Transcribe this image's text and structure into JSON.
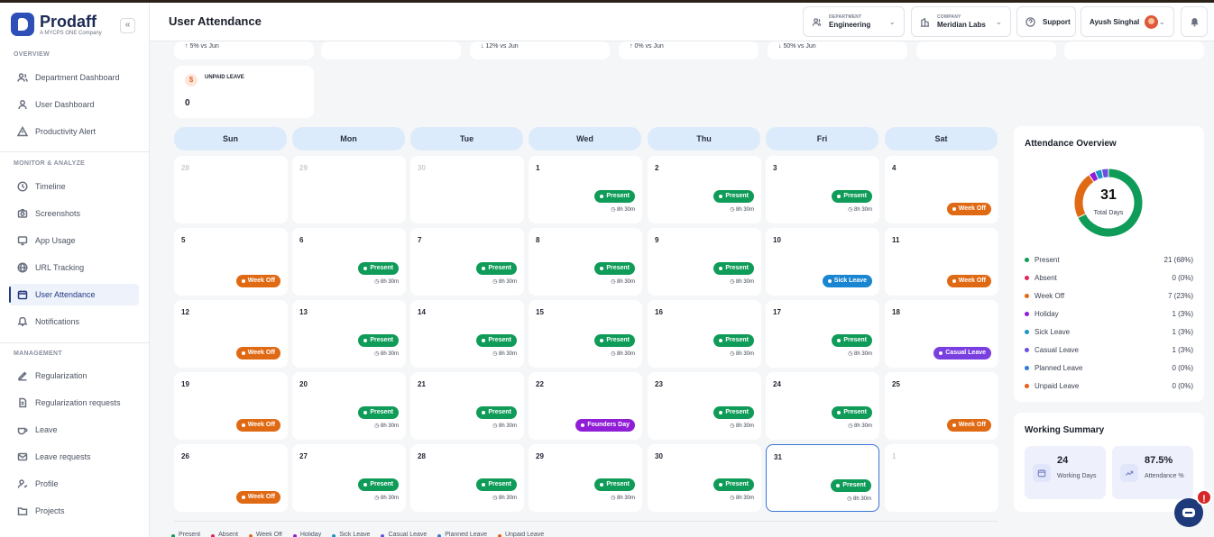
{
  "brand": {
    "name": "Prodaff",
    "tagline": "A MYCPS ONE Company",
    "collapse_icon": "«"
  },
  "sidebar": {
    "sections": [
      {
        "label": "OVERVIEW",
        "items": [
          "Department Dashboard",
          "User Dashboard",
          "Productivity Alert"
        ]
      },
      {
        "label": "MONITOR & ANALYZE",
        "items": [
          "Timeline",
          "Screenshots",
          "App Usage",
          "URL Tracking",
          "User Attendance",
          "Notifications"
        ]
      },
      {
        "label": "MANAGEMENT",
        "items": [
          "Regularization",
          "Regularization requests",
          "Leave",
          "Leave requests",
          "Profile",
          "Projects"
        ]
      }
    ],
    "active_item": "User Attendance"
  },
  "header": {
    "title": "User Attendance",
    "department": {
      "label": "DEPARTMENT",
      "value": "Engineering"
    },
    "company": {
      "label": "COMPANY",
      "value": "Meridian Labs"
    },
    "support_label": "Support",
    "user_name": "Ayush Singhal"
  },
  "stat_cards": {
    "trends": [
      "↑ 5% vs Jun",
      "↓ 12% vs Jun",
      "↑ 0% vs Jun",
      "↓ 50% vs Jun"
    ],
    "unpaid_leave": {
      "label": "UNPAID LEAVE",
      "value": "0",
      "icon": "$"
    }
  },
  "calendar": {
    "days": [
      "Sun",
      "Mon",
      "Tue",
      "Wed",
      "Thu",
      "Fri",
      "Sat"
    ],
    "hours_text": "8h 30m",
    "status_colors": {
      "Present": "#0f9b58",
      "Week Off": "#e06a14",
      "Sick Leave": "#1a85d0",
      "Casual Leave": "#7a3fe0",
      "Founders Day": "#8f1ed6"
    },
    "weeks": [
      [
        {
          "d": "28",
          "muted": true
        },
        {
          "d": "29",
          "muted": true
        },
        {
          "d": "30",
          "muted": true
        },
        {
          "d": "1",
          "status": "Present"
        },
        {
          "d": "2",
          "status": "Present"
        },
        {
          "d": "3",
          "status": "Present"
        },
        {
          "d": "4",
          "status": "Week Off"
        }
      ],
      [
        {
          "d": "5",
          "status": "Week Off"
        },
        {
          "d": "6",
          "status": "Present"
        },
        {
          "d": "7",
          "status": "Present"
        },
        {
          "d": "8",
          "status": "Present"
        },
        {
          "d": "9",
          "status": "Present"
        },
        {
          "d": "10",
          "status": "Sick Leave"
        },
        {
          "d": "11",
          "status": "Week Off"
        }
      ],
      [
        {
          "d": "12",
          "status": "Week Off"
        },
        {
          "d": "13",
          "status": "Present"
        },
        {
          "d": "14",
          "status": "Present"
        },
        {
          "d": "15",
          "status": "Present"
        },
        {
          "d": "16",
          "status": "Present"
        },
        {
          "d": "17",
          "status": "Present"
        },
        {
          "d": "18",
          "status": "Casual Leave"
        }
      ],
      [
        {
          "d": "19",
          "status": "Week Off"
        },
        {
          "d": "20",
          "status": "Present"
        },
        {
          "d": "21",
          "status": "Present"
        },
        {
          "d": "22",
          "status": "Founders Day"
        },
        {
          "d": "23",
          "status": "Present"
        },
        {
          "d": "24",
          "status": "Present"
        },
        {
          "d": "25",
          "status": "Week Off"
        }
      ],
      [
        {
          "d": "26",
          "status": "Week Off"
        },
        {
          "d": "27",
          "status": "Present"
        },
        {
          "d": "28",
          "status": "Present"
        },
        {
          "d": "29",
          "status": "Present"
        },
        {
          "d": "30",
          "status": "Present"
        },
        {
          "d": "31",
          "status": "Present",
          "today": true
        },
        {
          "d": "1",
          "muted": true
        }
      ]
    ],
    "legend": [
      "Present",
      "Absent",
      "Week Off",
      "Holiday",
      "Sick Leave",
      "Casual Leave",
      "Planned Leave",
      "Unpaid Leave"
    ]
  },
  "overview": {
    "title": "Attendance Overview",
    "total": "31",
    "total_label": "Total Days",
    "rows": [
      {
        "label": "Present",
        "value": "21 (68%)",
        "color": "#0f9b58",
        "count": 21
      },
      {
        "label": "Absent",
        "value": "0 (0%)",
        "color": "#e0245e",
        "count": 0
      },
      {
        "label": "Week Off",
        "value": "7 (23%)",
        "color": "#e06a14",
        "count": 7
      },
      {
        "label": "Holiday",
        "value": "1 (3%)",
        "color": "#8f1ed6",
        "count": 1
      },
      {
        "label": "Sick Leave",
        "value": "1 (3%)",
        "color": "#1a95c8",
        "count": 1
      },
      {
        "label": "Casual Leave",
        "value": "1 (3%)",
        "color": "#6a4fe0",
        "count": 1
      },
      {
        "label": "Planned Leave",
        "value": "0 (0%)",
        "color": "#2f7be0",
        "count": 0
      },
      {
        "label": "Unpaid Leave",
        "value": "0 (0%)",
        "color": "#e8601c",
        "count": 0
      }
    ]
  },
  "working_summary": {
    "title": "Working Summary",
    "working_days": {
      "value": "24",
      "label": "Working Days"
    },
    "attendance": {
      "value": "87.5%",
      "label": "Attendance %"
    }
  },
  "chat": {
    "alert": "!"
  }
}
